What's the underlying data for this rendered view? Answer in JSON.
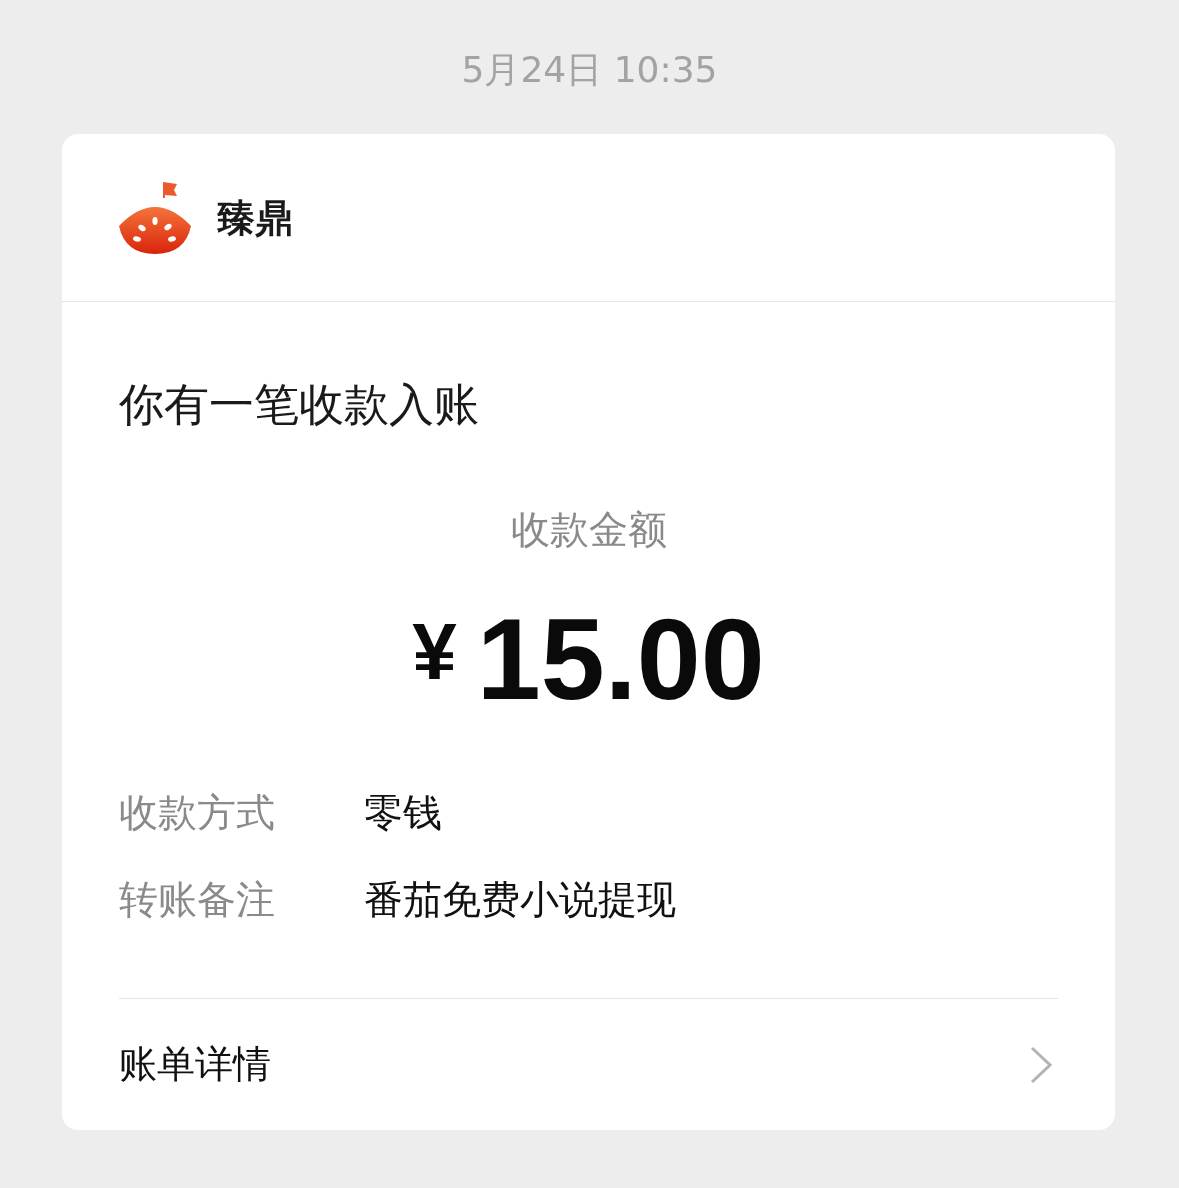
{
  "timestamp": "5月24日 10:35",
  "card": {
    "merchant": {
      "name": "臻鼎"
    },
    "title": "你有一笔收款入账",
    "amount": {
      "label": "收款金额",
      "currency": "¥",
      "value": "15.00"
    },
    "details": [
      {
        "label": "收款方式",
        "value": "零钱"
      },
      {
        "label": "转账备注",
        "value": "番茄免费小说提现"
      }
    ],
    "footer": {
      "label": "账单详情"
    }
  }
}
